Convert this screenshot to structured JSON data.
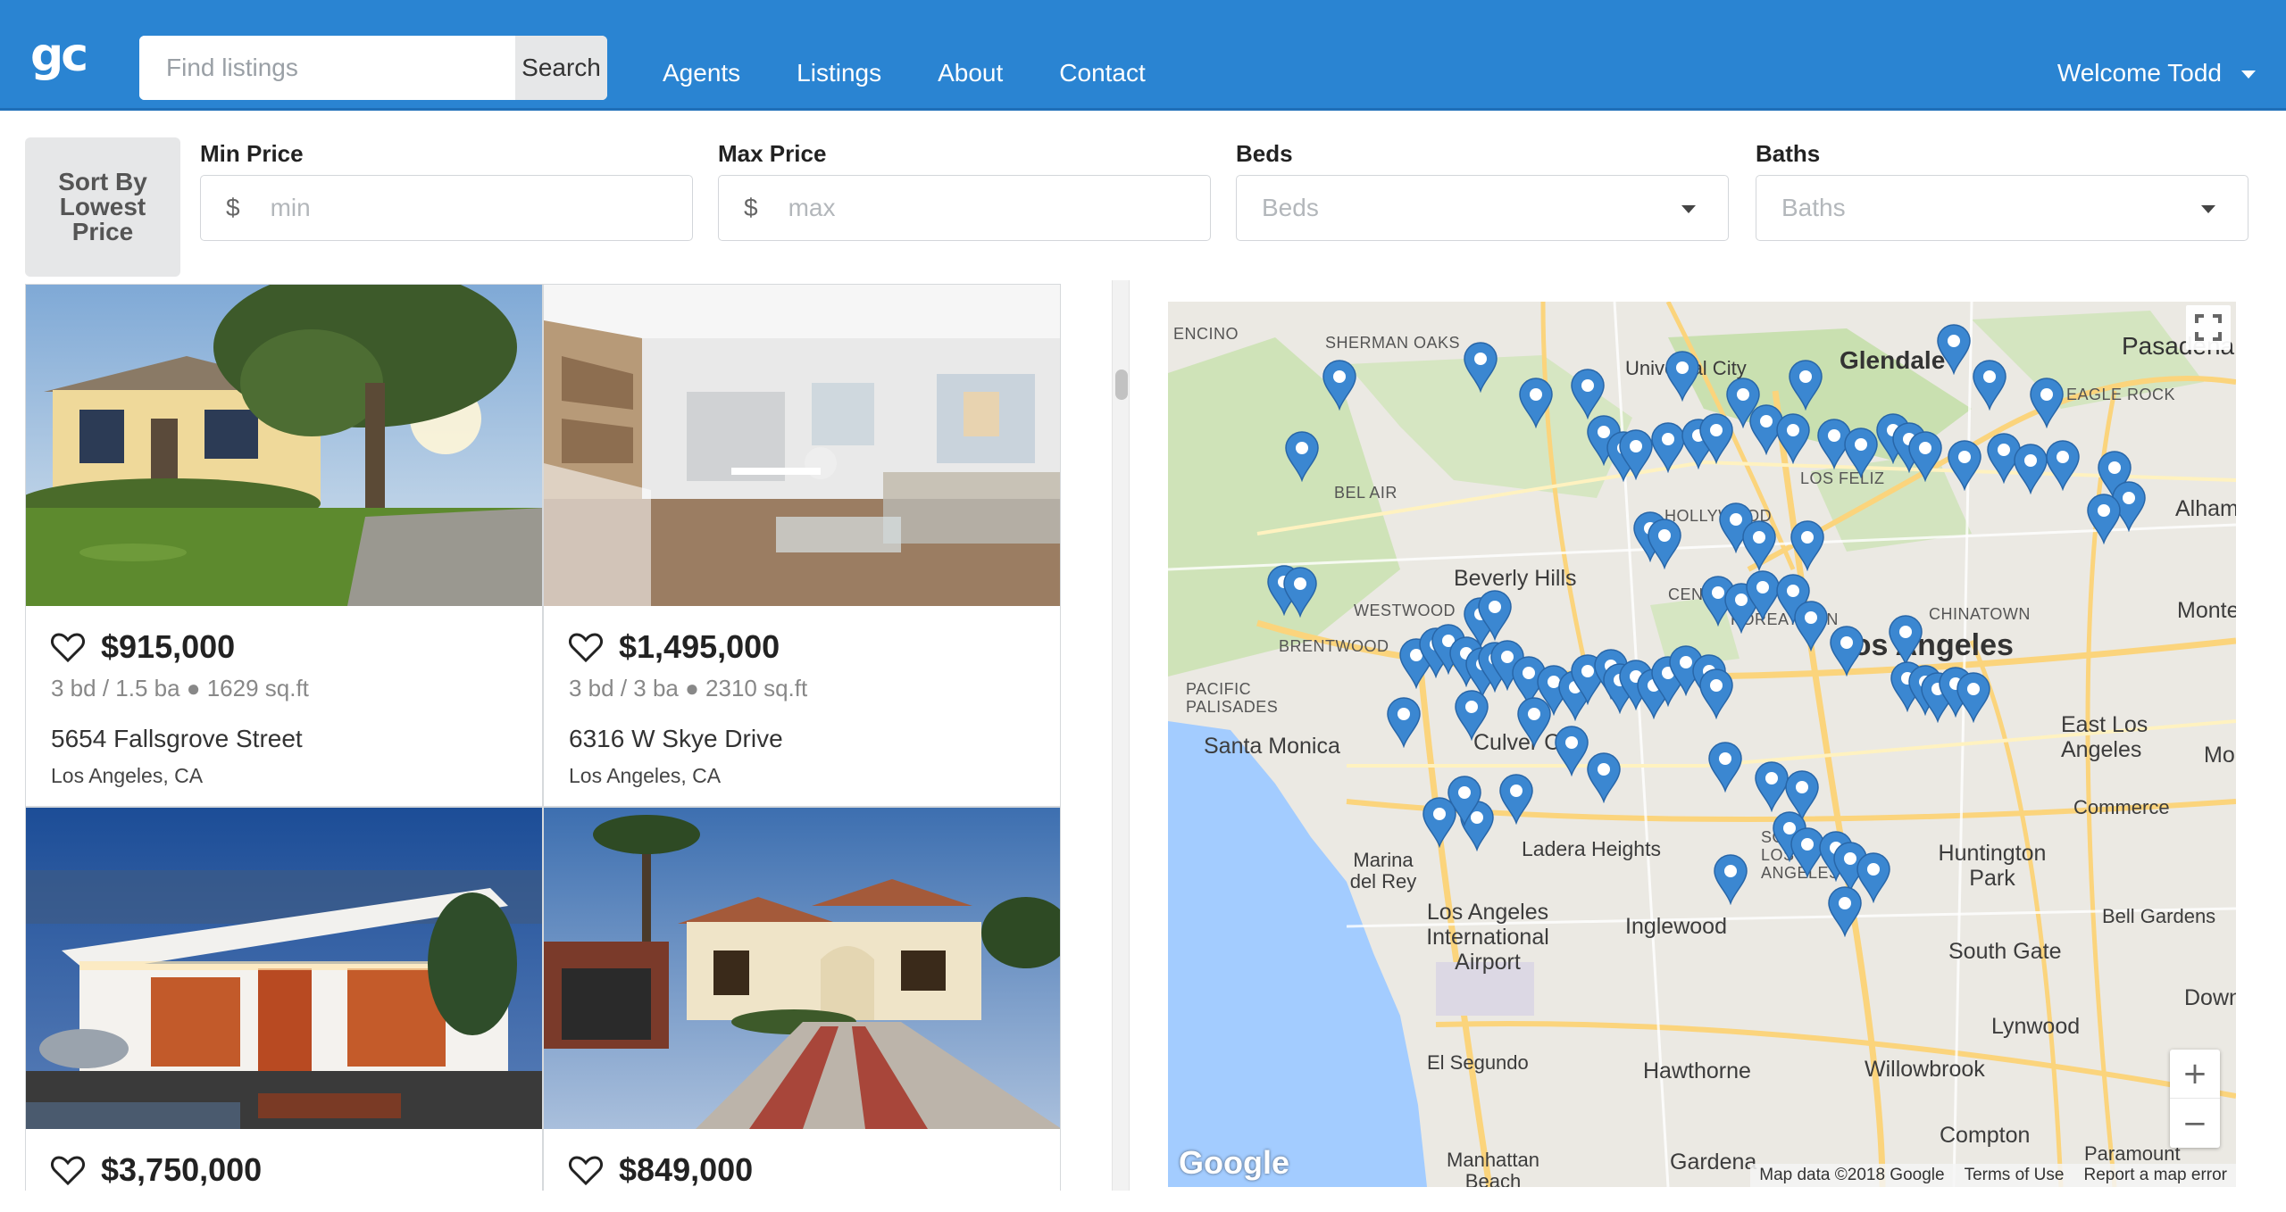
{
  "header": {
    "logo": "gc",
    "search_placeholder": "Find listings",
    "search_button": "Search",
    "nav": [
      "Agents",
      "Listings",
      "About",
      "Contact"
    ],
    "welcome": "Welcome Todd"
  },
  "filters": {
    "sort_button": "Sort By Lowest Price",
    "min_price": {
      "label": "Min Price",
      "currency": "$",
      "placeholder": "min"
    },
    "max_price": {
      "label": "Max Price",
      "currency": "$",
      "placeholder": "max"
    },
    "beds": {
      "label": "Beds",
      "placeholder": "Beds"
    },
    "baths": {
      "label": "Baths",
      "placeholder": "Baths"
    }
  },
  "listings": [
    {
      "price": "$915,000",
      "specs": "3 bd / 1.5 ba ● 1629 sq.ft",
      "address": "5654 Fallsgrove Street",
      "city": "Los Angeles, CA",
      "photo": "house-yellow-exterior"
    },
    {
      "price": "$1,495,000",
      "specs": "3 bd / 3 ba ● 2310 sq.ft",
      "address": "6316 W Skye Drive",
      "city": "Los Angeles, CA",
      "photo": "modern-living-room"
    },
    {
      "price": "$3,750,000",
      "photo": "modern-house-dusk"
    },
    {
      "price": "$849,000",
      "photo": "spanish-house-dusk"
    }
  ],
  "map": {
    "labels": {
      "glendale": "Glendale",
      "universal_city": "Universal City",
      "sherman_oaks": "SHERMAN OAKS",
      "encino": "ENCINO",
      "pasadena": "Pasadena",
      "eagle_rock": "EAGLE ROCK",
      "alhambra": "Alham",
      "bel_air": "BEL AIR",
      "beverly_hills": "Beverly Hills",
      "westwood": "WESTWOOD",
      "brentwood": "BRENTWOOD",
      "hollywood": "HOLLYWOOD",
      "los_feliz": "LOS FELIZ",
      "central_la": "CENTRAL LA",
      "koreatown": "KOREATOWN",
      "chinatown": "CHINATOWN",
      "los_angeles": "Los Angeles",
      "monterey": "Monter",
      "pacific_palisades": "PACIFIC PALISADES",
      "santa_monica": "Santa Monica",
      "culver_city": "Culver City",
      "east_la": "East Los Angeles",
      "commerce": "Commerce",
      "marina_del_rey": "Marina del Rey",
      "ladera_heights": "Ladera Heights",
      "south_la": "SOUTH LOS ANGELES",
      "huntington_park": "Huntington Park",
      "lax": "Los Angeles International Airport",
      "inglewood": "Inglewood",
      "bell_gardens": "Bell Gardens",
      "south_gate": "South Gate",
      "downey": "Downe",
      "lynwood": "Lynwood",
      "el_segundo": "El Segundo",
      "hawthorne": "Hawthorne",
      "willowbrook": "Willowbrook",
      "compton": "Compton",
      "paramount": "Paramount",
      "gardena": "Gardena",
      "manhattan_beach": "Manhattan Beach",
      "mo": "Mo"
    },
    "zoom_in": "+",
    "zoom_out": "−",
    "google": "Google",
    "map_data": "Map data ©2018 Google",
    "terms": "Terms of Use",
    "report": "Report a map error",
    "marker_color": "#3b87d1",
    "marker_count": 90
  },
  "colors": {
    "header": "#2a84d2",
    "accent": "#3b87d1"
  }
}
